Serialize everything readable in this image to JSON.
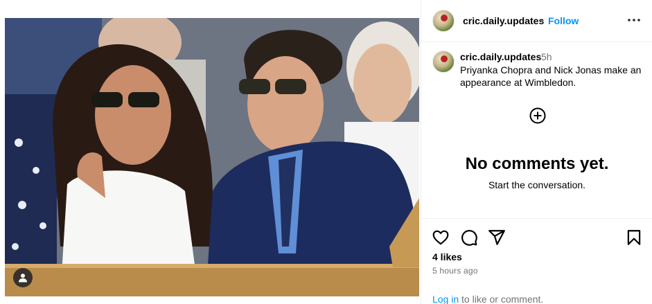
{
  "post": {
    "username": "cric.daily.updates",
    "separator": "•",
    "follow_label": "Follow",
    "caption_username": "cric.daily.updates",
    "caption_time": "5h",
    "caption_text": "Priyanka Chopra and Nick Jonas make an appearance at Wimbledon."
  },
  "comments": {
    "empty_title": "No comments yet.",
    "empty_subtitle": "Start the conversation."
  },
  "footer": {
    "likes": "4 likes",
    "time_ago": "5 hours ago",
    "login_link": "Log in",
    "login_rest": " to like or comment."
  },
  "icons": {
    "more": "more-options-icon",
    "user_tag": "user-tag-icon",
    "add": "add-circle-icon",
    "like": "heart-icon",
    "comment": "comment-icon",
    "share": "share-icon",
    "save": "bookmark-icon"
  },
  "colors": {
    "link_blue": "#0095f6",
    "muted_text": "#737373",
    "divider": "#efefef"
  }
}
